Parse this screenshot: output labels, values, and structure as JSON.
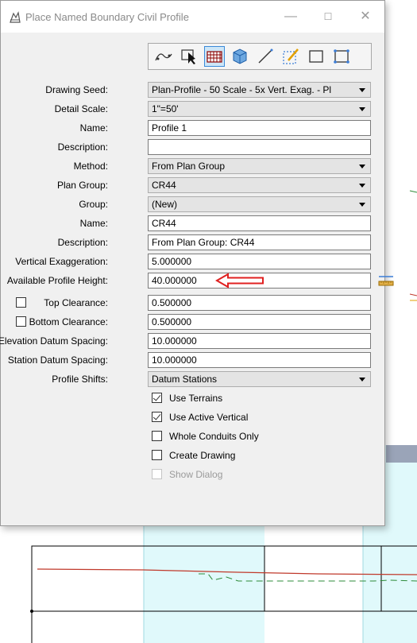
{
  "window": {
    "title": "Place Named Boundary Civil Profile",
    "minimize_icon": "minimize-icon",
    "maximize_icon": "maximize-icon",
    "close_icon": "close-icon"
  },
  "toolbar": {
    "tools": [
      "civil-profile-icon",
      "select-element-icon",
      "profile-grid-icon",
      "3d-box-icon",
      "line-icon",
      "edit-line-icon",
      "rectangle-icon",
      "shape-icon"
    ],
    "active_tool": "profile-grid-icon"
  },
  "form": {
    "drawing_seed": {
      "label": "Drawing Seed:",
      "value": "Plan-Profile - 50 Scale - 5x Vert. Exag. - Pl"
    },
    "detail_scale": {
      "label": "Detail Scale:",
      "value": "1\"=50'"
    },
    "name": {
      "label": "Name:",
      "value": "Profile 1"
    },
    "description": {
      "label": "Description:",
      "value": ""
    },
    "method": {
      "label": "Method:",
      "value": "From Plan Group"
    },
    "plan_group": {
      "label": "Plan Group:",
      "value": "CR44"
    },
    "group": {
      "label": "Group:",
      "value": "(New)"
    },
    "group_name": {
      "label": "Name:",
      "value": "CR44"
    },
    "group_description": {
      "label": "Description:",
      "value": "From Plan Group: CR44"
    },
    "vertical_exaggeration": {
      "label": "Vertical Exaggeration:",
      "value": "5.000000"
    },
    "available_profile_height": {
      "label": "Available Profile Height:",
      "value": "40.000000"
    },
    "top_clearance": {
      "label": "Top Clearance:",
      "value": "0.500000",
      "checked": false
    },
    "bottom_clearance": {
      "label": "Bottom Clearance:",
      "value": "0.500000",
      "checked": false
    },
    "elevation_datum_spacing": {
      "label": "Elevation Datum Spacing:",
      "value": "10.000000"
    },
    "station_datum_spacing": {
      "label": "Station Datum Spacing:",
      "value": "10.000000"
    },
    "profile_shifts": {
      "label": "Profile Shifts:",
      "value": "Datum Stations"
    }
  },
  "checkboxes": {
    "use_terrains": {
      "label": "Use Terrains",
      "checked": true
    },
    "use_active_vertical": {
      "label": "Use Active Vertical",
      "checked": true
    },
    "whole_conduits_only": {
      "label": "Whole Conduits Only",
      "checked": false
    },
    "create_drawing": {
      "label": "Create Drawing",
      "checked": false
    },
    "show_dialog": {
      "label": "Show Dialog",
      "checked": false,
      "disabled": true
    }
  },
  "annotations": {
    "arrow_color": "#e02020",
    "measure_icon": "measure-height-icon"
  },
  "colors": {
    "highlight_band": "#e0f9fb",
    "profile_line": "#c0392b",
    "ground_line": "#2e8b3a"
  }
}
